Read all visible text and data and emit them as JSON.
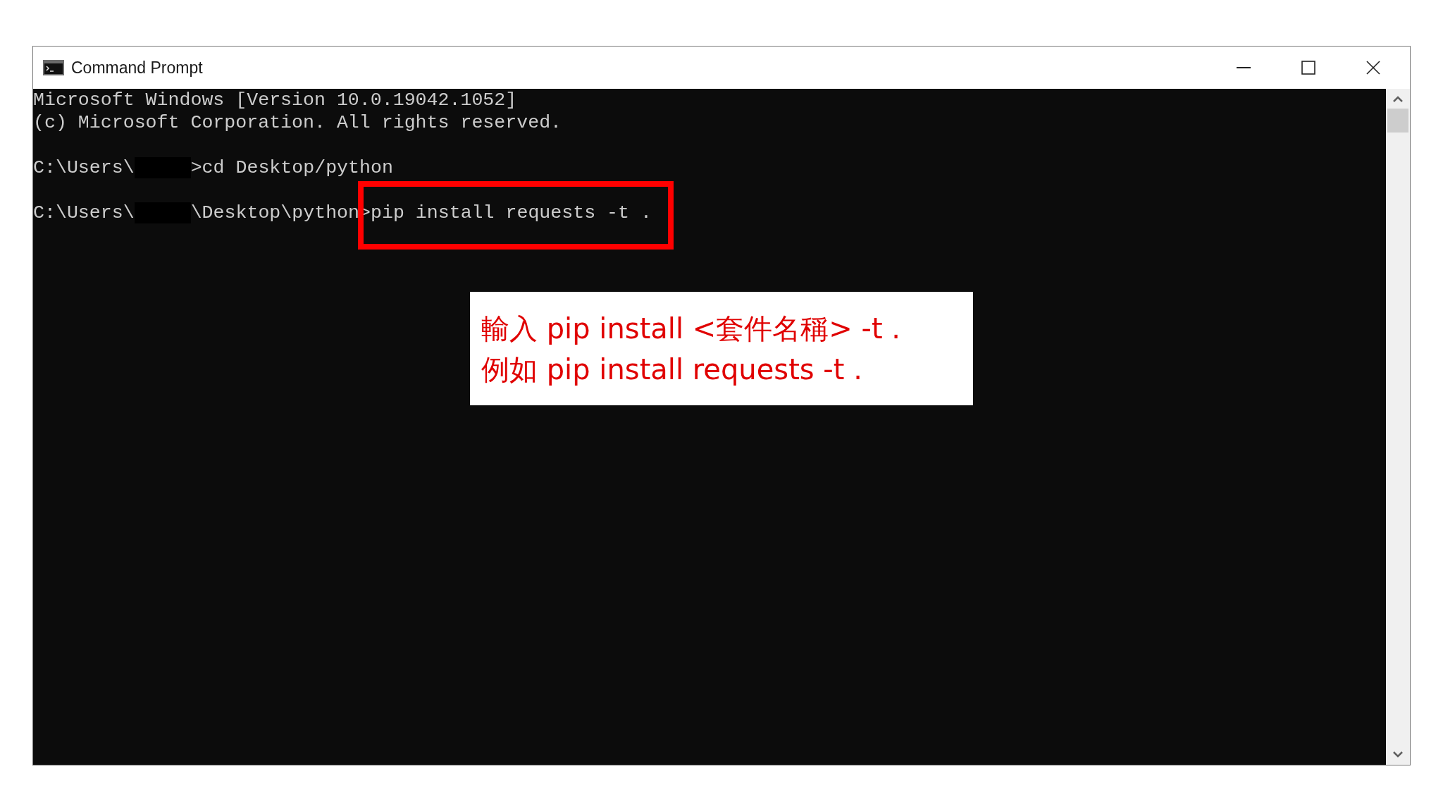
{
  "window": {
    "title": "Command Prompt"
  },
  "console": {
    "lines": [
      {
        "kind": "text",
        "text": "Microsoft Windows [Version 10.0.19042.1052]"
      },
      {
        "kind": "text",
        "text": "(c) Microsoft Corporation. All rights reserved."
      },
      {
        "kind": "blank"
      },
      {
        "kind": "prompt",
        "prefix": "C:\\Users\\",
        "suffix": ">cd Desktop/python"
      },
      {
        "kind": "blank"
      },
      {
        "kind": "prompt",
        "prefix": "C:\\Users\\",
        "suffix": "\\Desktop\\python>pip install requests -t ."
      }
    ]
  },
  "callout": {
    "lines": [
      "輸入 pip install <套件名稱> -t .",
      "例如 pip install requests -t ."
    ]
  }
}
